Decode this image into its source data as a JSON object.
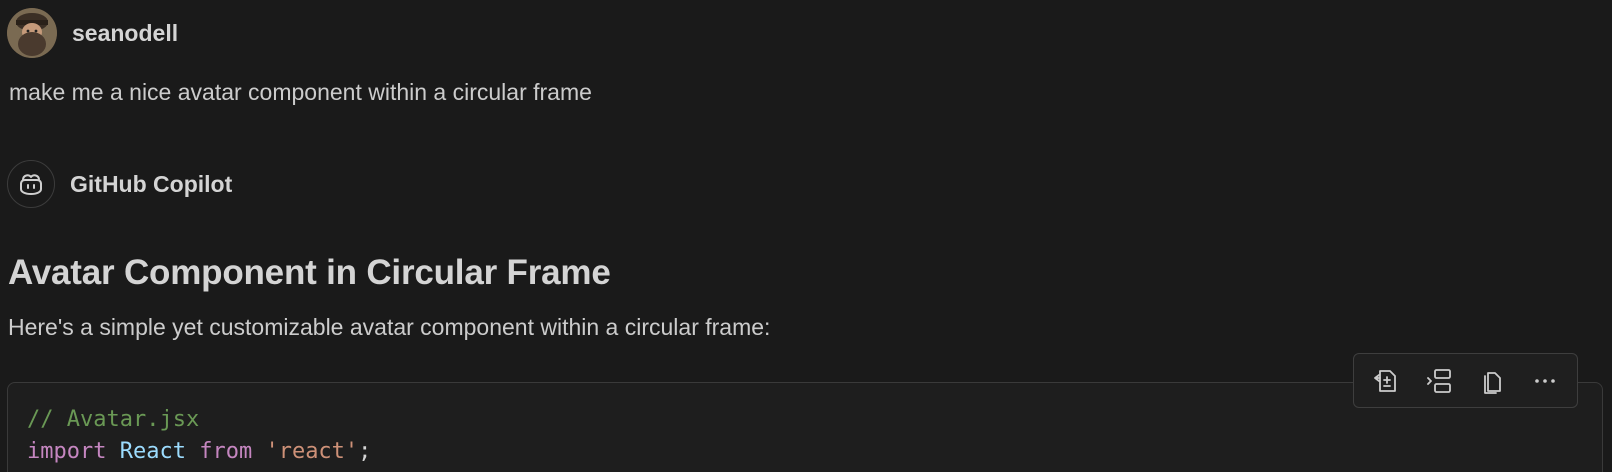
{
  "user": {
    "name": "seanodell",
    "message": "make me a nice avatar component within a circular frame"
  },
  "assistant": {
    "name": "GitHub Copilot",
    "icon": "copilot-icon"
  },
  "response": {
    "heading": "Avatar Component in Circular Frame",
    "intro": "Here's a simple yet customizable avatar component within a circular frame:"
  },
  "code": {
    "line1": "// Avatar.jsx",
    "line2": {
      "kw_import": "import",
      "ident": "React",
      "kw_from": "from",
      "string": "'react'",
      "punct": ";"
    }
  },
  "toolbar": {
    "buttons": [
      {
        "icon": "apply-in-editor-icon"
      },
      {
        "icon": "insert-at-cursor-icon"
      },
      {
        "icon": "copy-icon"
      },
      {
        "icon": "more-actions-icon"
      }
    ]
  },
  "colors": {
    "background": "#1a1a1a",
    "code_background": "#1e1e1e",
    "comment": "#6a9955",
    "keyword": "#c586c0",
    "identifier": "#9cdcfe",
    "string": "#ce9178"
  }
}
